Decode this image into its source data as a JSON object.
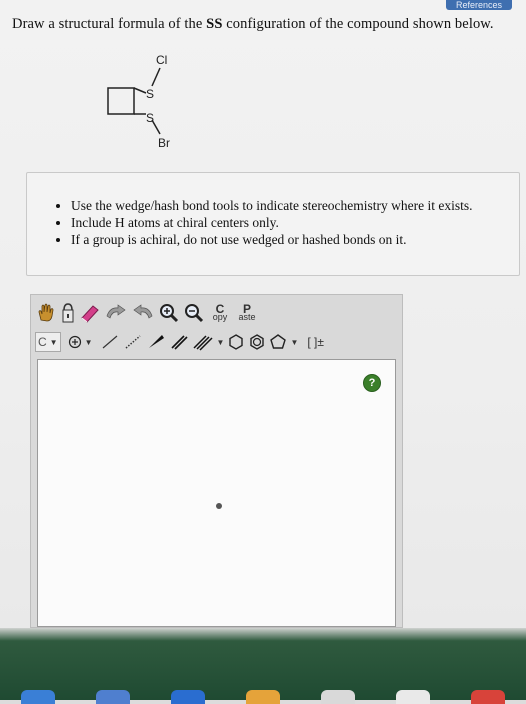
{
  "header": {
    "references_tab": "References"
  },
  "question": {
    "prefix": "Draw a structural formula of the ",
    "config": "SS",
    "suffix": " configuration of the compound shown below."
  },
  "molecule": {
    "label_top": "Cl",
    "label_s1": "S",
    "label_s2": "S",
    "label_bottom": "Br"
  },
  "instructions": {
    "items": [
      "Use the wedge/hash bond tools to indicate stereochemistry where it exists.",
      "Include H atoms at chiral centers only.",
      "If a group is achiral, do not use wedged or hashed bonds on it."
    ]
  },
  "toolbar": {
    "copy_big": "C",
    "copy_small": "opy",
    "paste_big": "P",
    "paste_small": "aste",
    "element_select": "C",
    "bracket_label": "[ ]±"
  },
  "canvas": {
    "help_label": "?"
  },
  "colors": {
    "accent_blue": "#3f6fb0",
    "help_green": "#3b7f2a",
    "eraser_pink": "#d33f8a"
  },
  "icons": [
    "hand-icon",
    "lasso-icon",
    "eraser-icon",
    "undo-icon",
    "redo-icon",
    "zoom-in-icon",
    "zoom-out-icon",
    "plus-circle-icon",
    "single-bond-icon",
    "hashed-bond-icon",
    "wedge-bond-icon",
    "double-bond-icon",
    "triple-bond-icon",
    "hexagon-icon",
    "benzene-icon",
    "pentagon-icon"
  ]
}
